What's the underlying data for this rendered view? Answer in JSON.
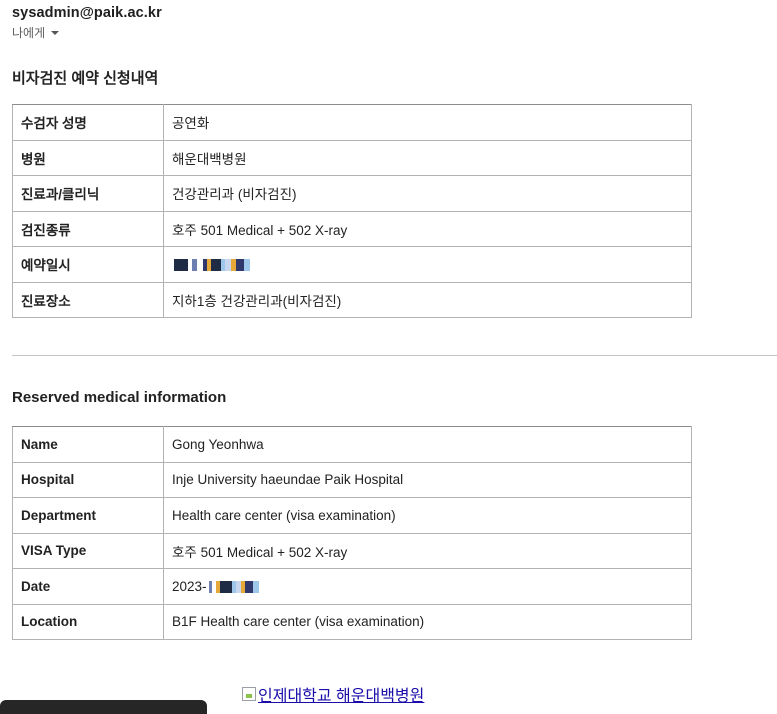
{
  "header": {
    "sender_email": "sysadmin@paik.ac.kr",
    "recipient_label": "나에게"
  },
  "ko": {
    "title": "비자검진 예약 신청내역",
    "rows": [
      {
        "label": "수검자 성명",
        "value": "공연화"
      },
      {
        "label": "병원",
        "value": "해운대백병원"
      },
      {
        "label": "진료과/클리닉",
        "value": "건강관리과 (비자검진)"
      },
      {
        "label": "검진종류",
        "value": "호주 501 Medical + 502 X-ray"
      },
      {
        "label": "예약일시",
        "value": ""
      },
      {
        "label": "진료장소",
        "value": "지하1층 건강관리과(비자검진)"
      }
    ]
  },
  "en": {
    "title": "Reserved medical information",
    "rows": [
      {
        "label": "Name",
        "value": "Gong Yeonhwa"
      },
      {
        "label": "Hospital",
        "value": "Inje University haeundae Paik Hospital"
      },
      {
        "label": "Department",
        "value": "Health care center (visa examination)"
      },
      {
        "label": "VISA Type",
        "value": "호주 501 Medical + 502 X-ray"
      },
      {
        "label": "Date",
        "value": "2023-"
      },
      {
        "label": "Location",
        "value": "B1F Health care center (visa examination)"
      }
    ]
  },
  "footer": {
    "logo_alt": "인제대학교 해운대백병원"
  },
  "colors": {
    "link": "#1a0dab",
    "redaction": [
      "#1f2a44",
      "#6d7fb0",
      "#e7a83a",
      "#9ec7ea",
      "#30386b",
      "#c9d6ef"
    ]
  }
}
